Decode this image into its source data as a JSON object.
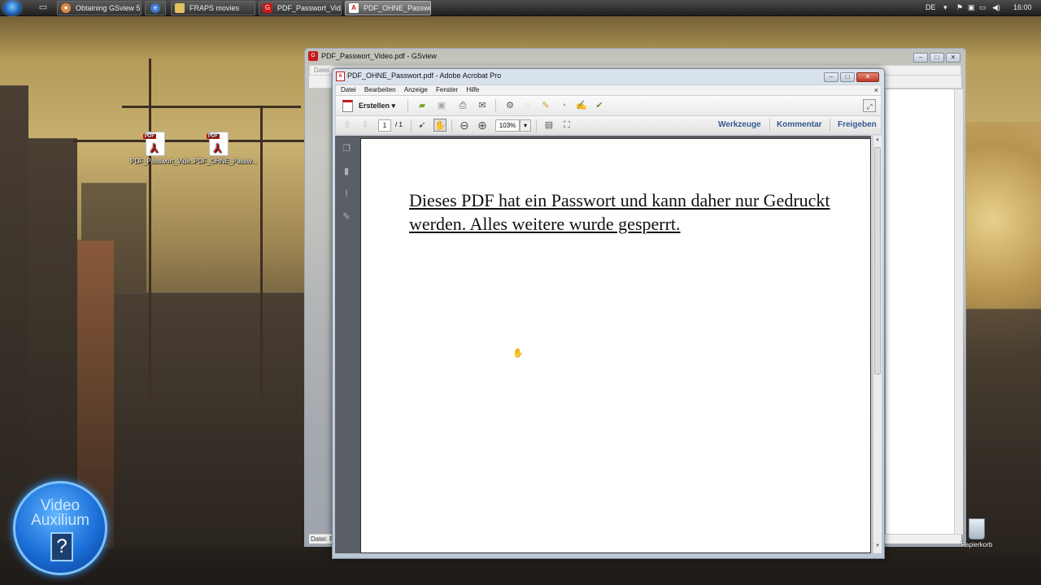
{
  "taskbar": {
    "buttons": [
      {
        "label": "Obtaining GSview 5...",
        "icon": "chrome-icon"
      },
      {
        "label": "",
        "icon": "ie-icon"
      },
      {
        "label": "FRAPS movies",
        "icon": "folder-icon"
      },
      {
        "label": "PDF_Passwort_Video...",
        "icon": "gsview-icon"
      },
      {
        "label": "PDF_OHNE_Passwort...",
        "icon": "acrobat-icon"
      }
    ],
    "tray": {
      "language": "DE",
      "clock": "16:00"
    }
  },
  "desktop": {
    "icons": [
      {
        "label": "PDF_Passwort_Vide...",
        "badge": "PDF"
      },
      {
        "label": "PDF_OHNE_Passw...",
        "badge": "PDF"
      }
    ],
    "trash_label": "Papierkorb",
    "logo": {
      "line1": "Video",
      "line2": "Auxilium",
      "mark": "?"
    }
  },
  "gsview": {
    "title": "PDF_Passwort_Video.pdf - GSview",
    "menu_first": "Datei",
    "status": "Datei: P"
  },
  "acrobat": {
    "title": "PDF_OHNE_Passwort.pdf - Adobe Acrobat Pro",
    "menu": [
      "Datei",
      "Bearbeiten",
      "Anzeige",
      "Fenster",
      "Hilfe"
    ],
    "create_label": "Erstellen",
    "page_current": "1",
    "page_total": "/ 1",
    "zoom": "103%",
    "right_links": [
      "Werkzeuge",
      "Kommentar",
      "Freigeben"
    ],
    "document_text": "Dieses PDF hat ein Passwort und kann daher nur Gedruckt werden. Alles weitere wurde gesperrt.",
    "cursor_icon": "hand-cursor-icon"
  },
  "colors": {
    "accent_link": "#355a8c",
    "pdf_red": "#c41a1a"
  }
}
